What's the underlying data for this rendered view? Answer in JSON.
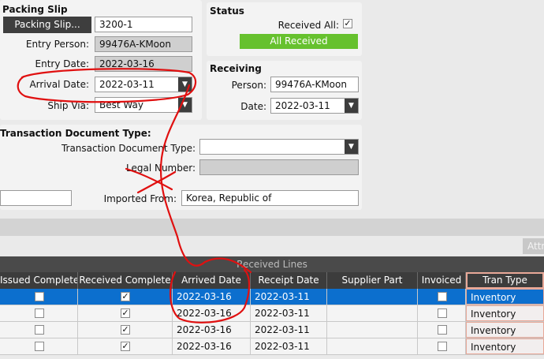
{
  "packing_slip": {
    "title": "Packing Slip",
    "button_label": "Packing Slip...",
    "slip_value": "3200-1",
    "entry_person_label": "Entry Person:",
    "entry_person_value": "99476A-KMoon",
    "entry_date_label": "Entry Date:",
    "entry_date_value": "2022-03-16",
    "arrival_date_label": "Arrival Date:",
    "arrival_date_value": "2022-03-11",
    "ship_via_label": "Ship Via:",
    "ship_via_value": "Best Way"
  },
  "status": {
    "title": "Status",
    "received_all_label": "Received All:",
    "received_all_checked": true,
    "badge_label": "All Received",
    "badge_color": "#66c12e"
  },
  "receiving": {
    "title": "Receiving",
    "person_label": "Person:",
    "person_value": "99476A-KMoon",
    "date_label": "Date:",
    "date_value": "2022-03-11"
  },
  "transaction": {
    "title": "Transaction Document Type:",
    "doc_type_label": "Transaction Document Type:",
    "doc_type_value": "",
    "legal_number_label": "Legal Number:",
    "legal_number_value": "",
    "imported_from_label": "Imported From:",
    "imported_from_value": "Korea, Republic of",
    "left_field_value": ""
  },
  "grid": {
    "caption": "Received Lines",
    "attr_button_label": "Attr",
    "columns": [
      "Issued Complete",
      "Received Complete",
      "Arrived Date",
      "Receipt Date",
      "Supplier Part",
      "Invoiced",
      "Tran Type"
    ],
    "rows": [
      {
        "issued_complete": false,
        "received_complete": true,
        "arrived_date": "2022-03-16",
        "receipt_date": "2022-03-11",
        "supplier_part": "",
        "invoiced": false,
        "tran_type": "Inventory",
        "selected": true
      },
      {
        "issued_complete": false,
        "received_complete": true,
        "arrived_date": "2022-03-16",
        "receipt_date": "2022-03-11",
        "supplier_part": "",
        "invoiced": false,
        "tran_type": "Inventory",
        "selected": false
      },
      {
        "issued_complete": false,
        "received_complete": true,
        "arrived_date": "2022-03-16",
        "receipt_date": "2022-03-11",
        "supplier_part": "",
        "invoiced": false,
        "tran_type": "Inventory",
        "selected": false
      },
      {
        "issued_complete": false,
        "received_complete": true,
        "arrived_date": "2022-03-16",
        "receipt_date": "2022-03-11",
        "supplier_part": "",
        "invoiced": false,
        "tran_type": "Inventory",
        "selected": false
      }
    ]
  },
  "annotation": {
    "ink_color": "#e01010"
  }
}
